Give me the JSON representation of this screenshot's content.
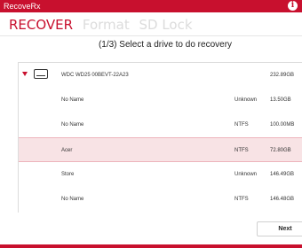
{
  "window": {
    "title": "RecoveRx"
  },
  "nav": {
    "tabs": [
      "RECOVER",
      "Format",
      "SD Lock"
    ],
    "active": "RECOVER"
  },
  "step_title": "(1/3) Select a drive to do recovery",
  "drive": {
    "name": "WDC WD25 00BEVT-22A23",
    "size": "232.89GB"
  },
  "partitions": [
    {
      "name": "No Name",
      "filesystem": "Unknown",
      "size": "13.50GB",
      "selected": false
    },
    {
      "name": "No Name",
      "filesystem": "NTFS",
      "size": "100.00MB",
      "selected": false
    },
    {
      "name": "Acer",
      "filesystem": "NTFS",
      "size": "72.80GB",
      "selected": true
    },
    {
      "name": "Store",
      "filesystem": "Unknown",
      "size": "146.49GB",
      "selected": false
    },
    {
      "name": "No Name",
      "filesystem": "NTFS",
      "size": "146.48GB",
      "selected": false
    }
  ],
  "buttons": {
    "next": "Next"
  },
  "colors": {
    "accent": "#c8102e",
    "inactive_tab": "#dcdcdc",
    "selected_row": "#f8e3e5"
  },
  "icons": {
    "info": "info-icon",
    "drive": "hard-drive-icon",
    "expand": "expand-triangle-icon"
  }
}
